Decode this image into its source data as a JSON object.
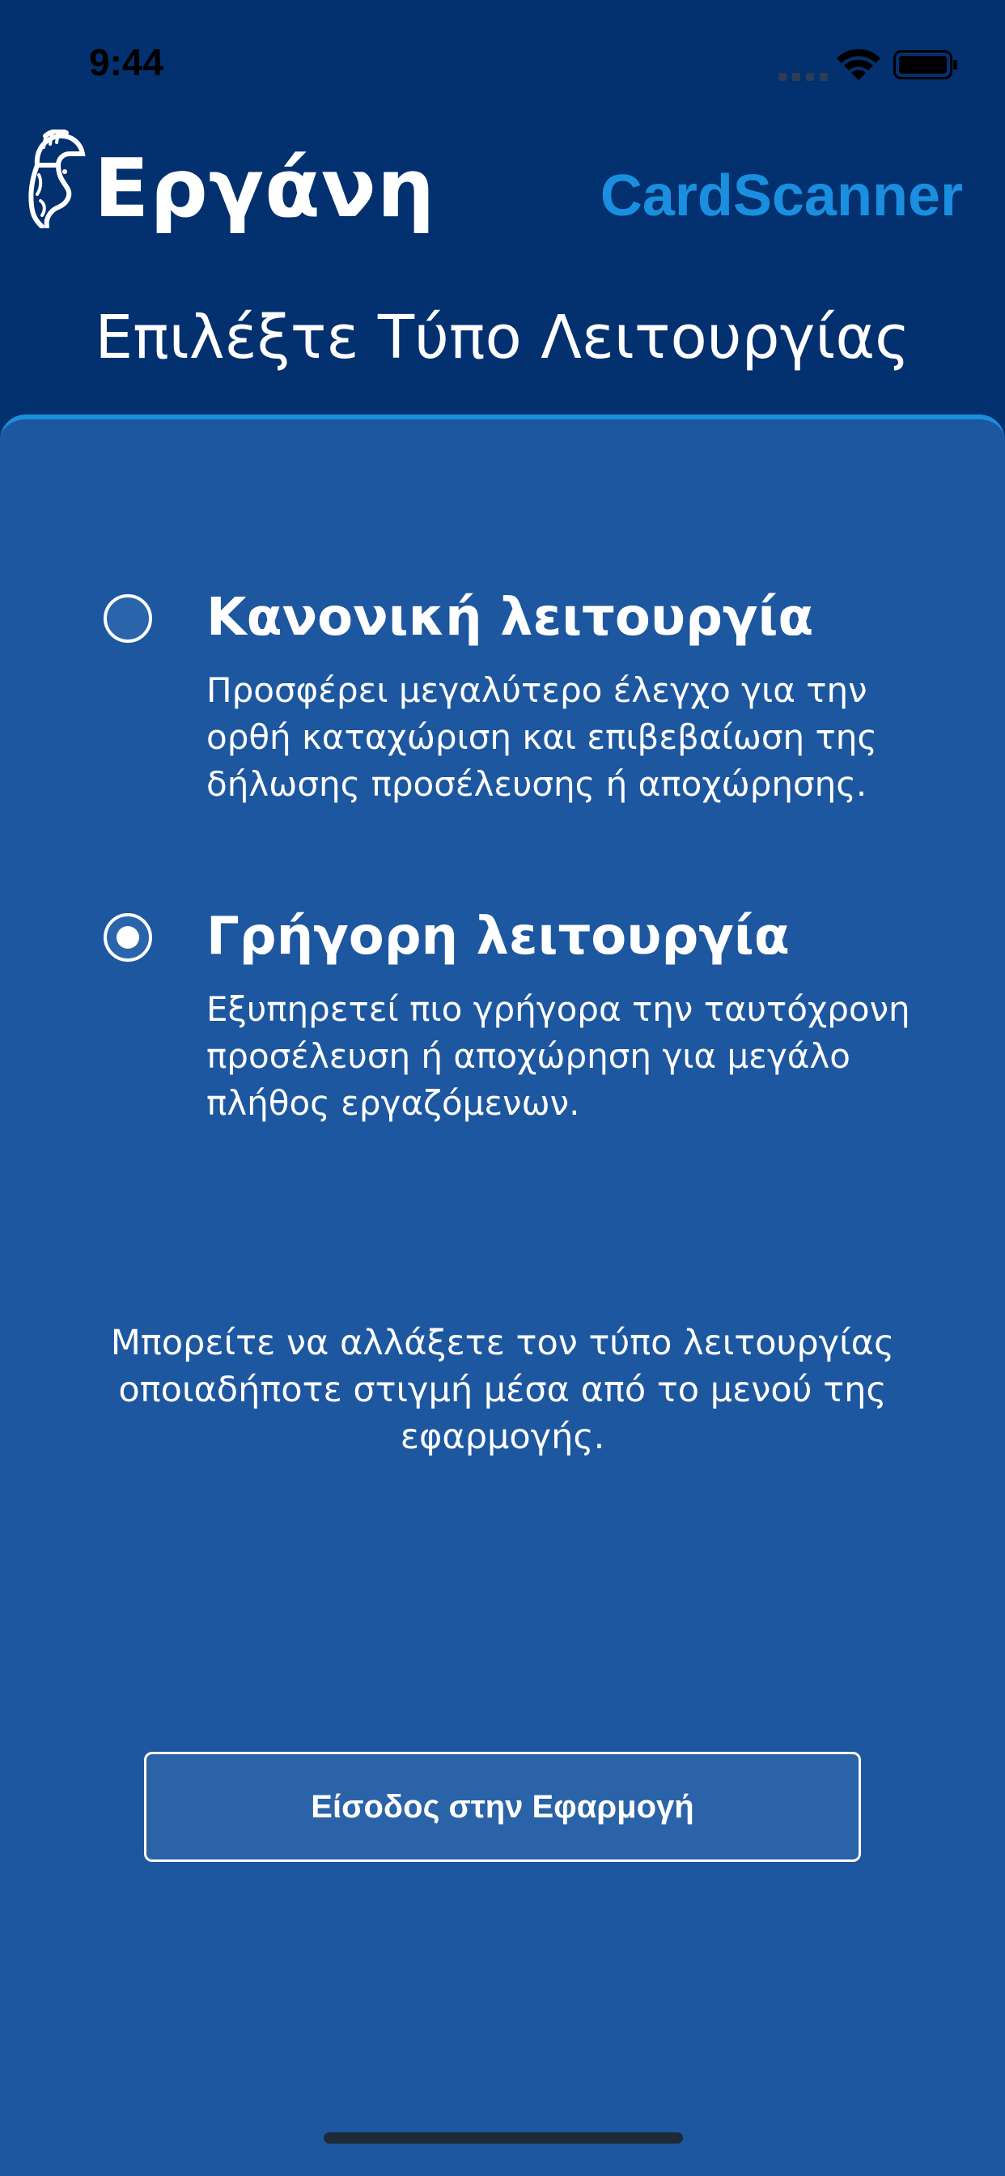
{
  "status_bar": {
    "time": "9:44",
    "icons": [
      "signal-icon",
      "wifi-icon",
      "battery-icon"
    ]
  },
  "header": {
    "logo_text": "Εργάνη",
    "app_name": "CardScanner",
    "title": "Επιλέξτε Τύπο Λειτουργίας"
  },
  "options": [
    {
      "title": "Κανονική λειτουργία",
      "description": "Προσφέρει μεγαλύτερο έλεγχο για την ορθή καταχώριση και επιβεβαίωση της δήλωσης προσέλευσης ή αποχώρησης.",
      "selected": false
    },
    {
      "title": "Γρήγορη λειτουργία",
      "description": "Εξυπηρετεί πιο γρήγορα την ταυτόχρονη προσέλευση ή αποχώρηση για μεγάλο πλήθος εργαζόμενων.",
      "selected": true
    }
  ],
  "info_text": "Μπορείτε να αλλάξετε τον τύπο λειτουργίας οποιαδήποτε στιγμή μέσα από το μενού της εφαρμογής.",
  "enter_button_label": "Είσοδος στην Εφαρμογή",
  "colors": {
    "header_background": "#03306f",
    "panel_background": "#1d57a0",
    "accent": "#1a8fdf",
    "button_background": "#2b63a8",
    "text": "#ffffff"
  }
}
